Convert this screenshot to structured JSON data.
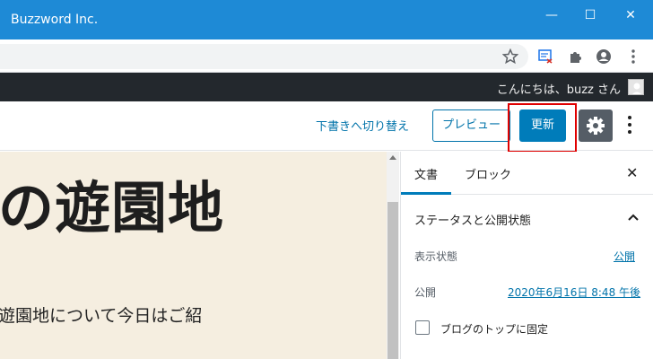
{
  "window": {
    "title": "Buzzword Inc.",
    "controls": {
      "minimize": "—",
      "maximize": "☐",
      "close": "✕"
    }
  },
  "browser_toolbar": {
    "icons": [
      "star-icon",
      "reading-list-icon",
      "extensions-icon",
      "profile-icon",
      "menu-icon"
    ]
  },
  "admin_bar": {
    "greeting": "こんにちは、buzz さん"
  },
  "editor_header": {
    "switch_to_draft": "下書きへ切り替え",
    "preview": "プレビュー",
    "update": "更新"
  },
  "content": {
    "title": "の遊園地",
    "body": "遊園地について今日はご紹"
  },
  "sidebar": {
    "tabs": [
      {
        "label": "文書"
      },
      {
        "label": "ブロック"
      }
    ],
    "close": "✕",
    "panel": {
      "title": "ステータスと公開状態",
      "visibility_label": "表示状態",
      "visibility_value": "公開",
      "publish_label": "公開",
      "publish_value": "2020年6月16日 8:48 午後",
      "stick_to_top": "ブログのトップに固定"
    }
  },
  "colors": {
    "titlebar": "#1e8ad6",
    "admin_bar": "#23282d",
    "primary": "#007cba",
    "highlight": "#e00000",
    "content_bg": "#f5eee0"
  }
}
